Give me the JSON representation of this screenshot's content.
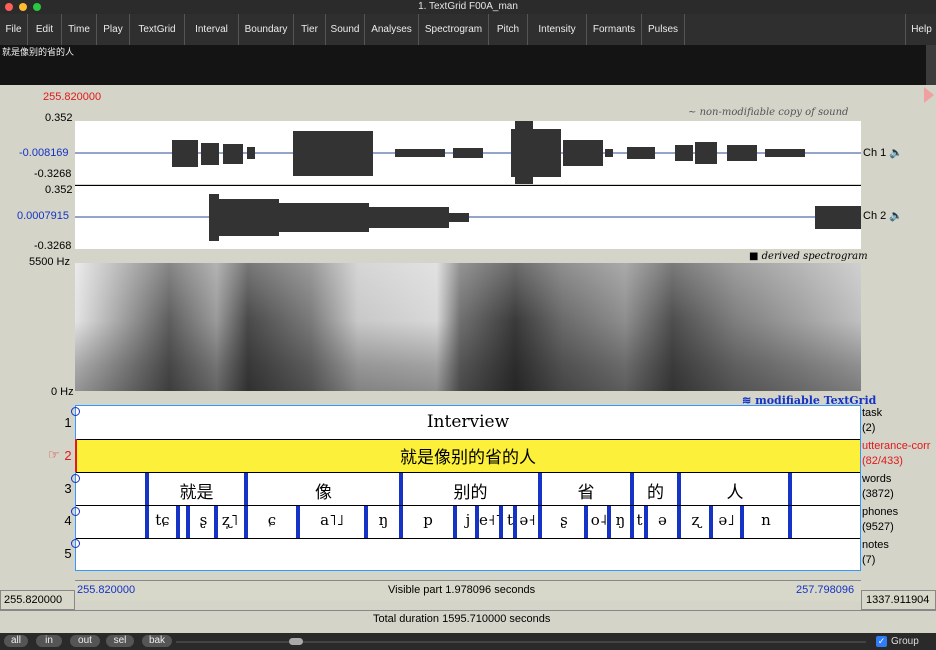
{
  "window": {
    "title": "1. TextGrid F00A_man"
  },
  "menu": [
    "File",
    "Edit",
    "Time",
    "Play",
    "TextGrid",
    "Interval",
    "Boundary",
    "Tier",
    "Sound",
    "Analyses",
    "Spectrogram",
    "Pitch",
    "Intensity",
    "Formants",
    "Pulses",
    "Help"
  ],
  "text_area": {
    "value": "就是像别的省的人"
  },
  "cursor_time": "255.820000",
  "sound": {
    "caption": "non-modifiable copy of sound",
    "ch1": {
      "label": "Ch 1",
      "top": "0.352",
      "mid": "-0.008169",
      "bottom": "-0.3268"
    },
    "ch2": {
      "label": "Ch 2",
      "top": "0.352",
      "mid": "0.0007915",
      "bottom": "-0.3268"
    }
  },
  "spectrogram": {
    "caption": "derived spectrogram",
    "top": "5500 Hz",
    "bottom": "0 Hz"
  },
  "textgrid": {
    "caption": "modifiable TextGrid",
    "tiers": [
      {
        "num": "1",
        "name": "task",
        "count": "(2)"
      },
      {
        "num": "2",
        "name": "utterance-corr",
        "count": "(82/433)"
      },
      {
        "num": "3",
        "name": "words",
        "count": "(3872)"
      },
      {
        "num": "4",
        "name": "phones",
        "count": "(9527)"
      },
      {
        "num": "5",
        "name": "notes",
        "count": "(7)"
      }
    ],
    "tier1_text": "Interview",
    "tier2_text": "就是像别的省的人",
    "words": [
      "就是",
      "像",
      "别的",
      "省",
      "的",
      "人"
    ],
    "phones": [
      "tɕ",
      "ʂ",
      "ʐ̩˥",
      "ɕ",
      "a˥˩",
      "ŋ",
      "p",
      "j",
      "e˧˥",
      "t",
      "ə˧",
      "ʂ",
      "o˨",
      "ŋ",
      "t",
      "ə",
      "ʐ",
      "ə˩",
      "n"
    ]
  },
  "visible": {
    "start": "255.820000",
    "end": "257.798096",
    "text": "Visible part 1.978096 seconds"
  },
  "window_range": {
    "start": "255.820000",
    "end": "1337.911904"
  },
  "total": {
    "text": "Total duration 1595.710000 seconds"
  },
  "bottom_buttons": [
    "all",
    "in",
    "out",
    "sel",
    "bak"
  ],
  "group": {
    "label": "Group",
    "checked": true
  }
}
